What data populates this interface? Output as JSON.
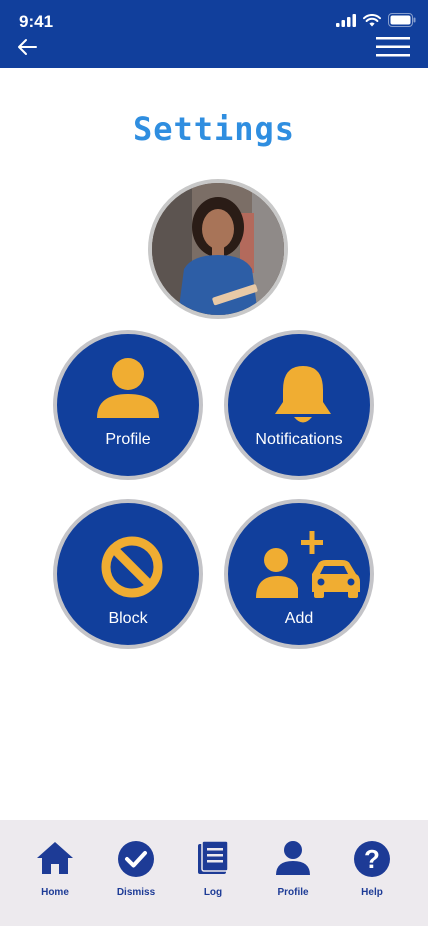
{
  "status_bar": {
    "time": "9:41"
  },
  "page": {
    "title": "Settings"
  },
  "tiles": [
    {
      "label": "Profile",
      "icon": "person-icon"
    },
    {
      "label": "Notifications",
      "icon": "bell-icon"
    },
    {
      "label": "Block",
      "icon": "block-icon"
    },
    {
      "label": "Add",
      "icon": "add-person-car-icon"
    }
  ],
  "bottom_nav": [
    {
      "label": "Home",
      "icon": "home-icon"
    },
    {
      "label": "Dismiss",
      "icon": "check-circle-icon"
    },
    {
      "label": "Log",
      "icon": "log-icon"
    },
    {
      "label": "Profile",
      "icon": "person-icon"
    },
    {
      "label": "Help",
      "icon": "help-icon"
    }
  ],
  "colors": {
    "primary": "#113f9c",
    "accent": "#f0ad32",
    "title": "#2f8ee0",
    "nav_bg": "#edeaee"
  }
}
